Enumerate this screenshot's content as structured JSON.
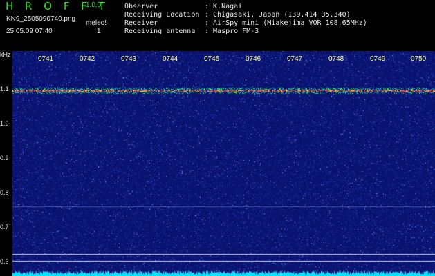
{
  "header": {
    "app_title": "H R O F F T",
    "app_version": "1.0.0f",
    "filename": "KN9_2505090740.png",
    "meleo_label": "meleo!",
    "meleo_value": "1",
    "datetime": "25.05.09 07:40"
  },
  "meta": [
    {
      "label": "Observer",
      "value": ": K.Nagai"
    },
    {
      "label": "Receiving Location",
      "value": ": Chigasaki, Japan (139.414 35.340)"
    },
    {
      "label": "Receiver",
      "value": ": AirSpy mini (Miakejima VOR 108.65MHz)"
    },
    {
      "label": "Receiving antenna",
      "value": ": Maspro FM-3"
    }
  ],
  "spectrogram": {
    "y_unit": "kHz",
    "y_ticks": [
      "1.1",
      "1.0",
      "0.9",
      "0.8",
      "0.7",
      "0.6"
    ],
    "time_labels": [
      "0741",
      "0742",
      "0743",
      "0744",
      "0745",
      "0746",
      "0747",
      "0748",
      "0749",
      "0750"
    ],
    "colors": {
      "background": "#0a1470",
      "noise": "#2a4ad8",
      "signal": "#ff3b3b",
      "floor": "#00e5ff"
    }
  }
}
